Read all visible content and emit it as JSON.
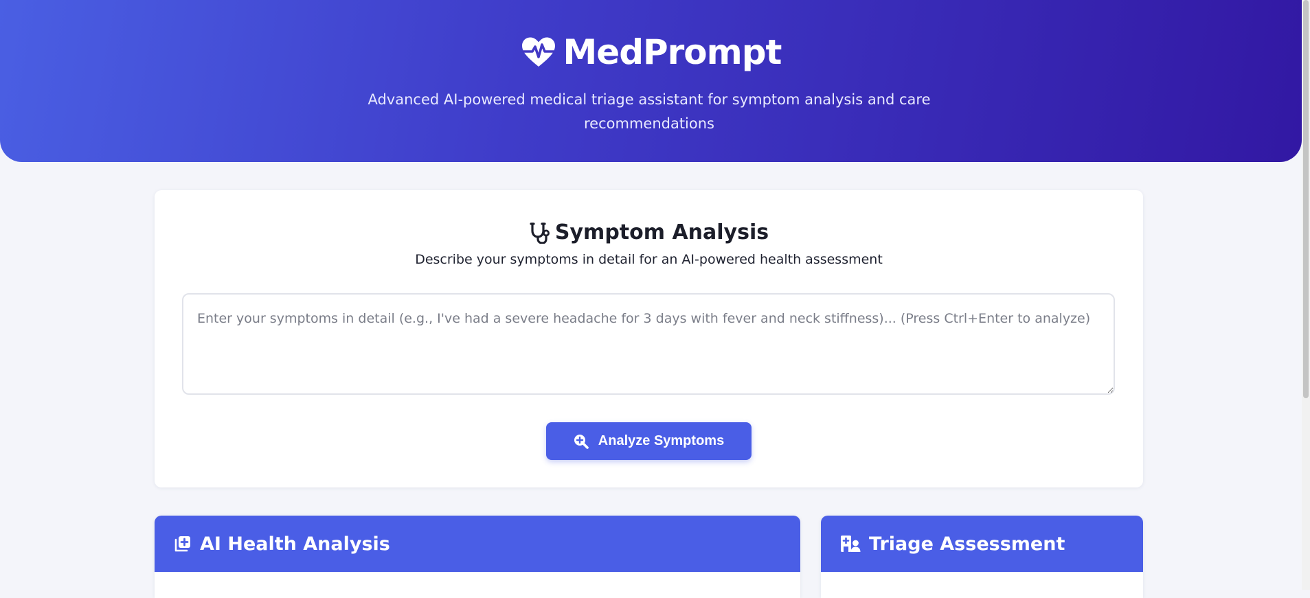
{
  "app": {
    "name": "MedPrompt",
    "tagline": "Advanced AI-powered medical triage assistant for symptom analysis and care recommendations"
  },
  "symptom_card": {
    "title": "Symptom Analysis",
    "subtitle": "Describe your symptoms in detail for an AI-powered health assessment",
    "input_placeholder": "Enter your symptoms in detail (e.g., I've had a severe headache for 3 days with fever and neck stiffness)... (Press Ctrl+Enter to analyze)",
    "input_value": "",
    "analyze_label": "Analyze Symptoms"
  },
  "panels": {
    "health_analysis_title": "AI Health Analysis",
    "triage_title": "Triage Assessment"
  },
  "icons": {
    "brand": "heart-pulse-icon",
    "symptom": "stethoscope-icon",
    "analyze": "search-plus-icon",
    "health_analysis": "notes-medical-icon",
    "triage": "hospital-user-icon"
  },
  "colors": {
    "accent": "#4a5ee6",
    "hero_start": "#4a5fe3",
    "hero_end": "#3218a3",
    "background": "#f4f5fa"
  }
}
